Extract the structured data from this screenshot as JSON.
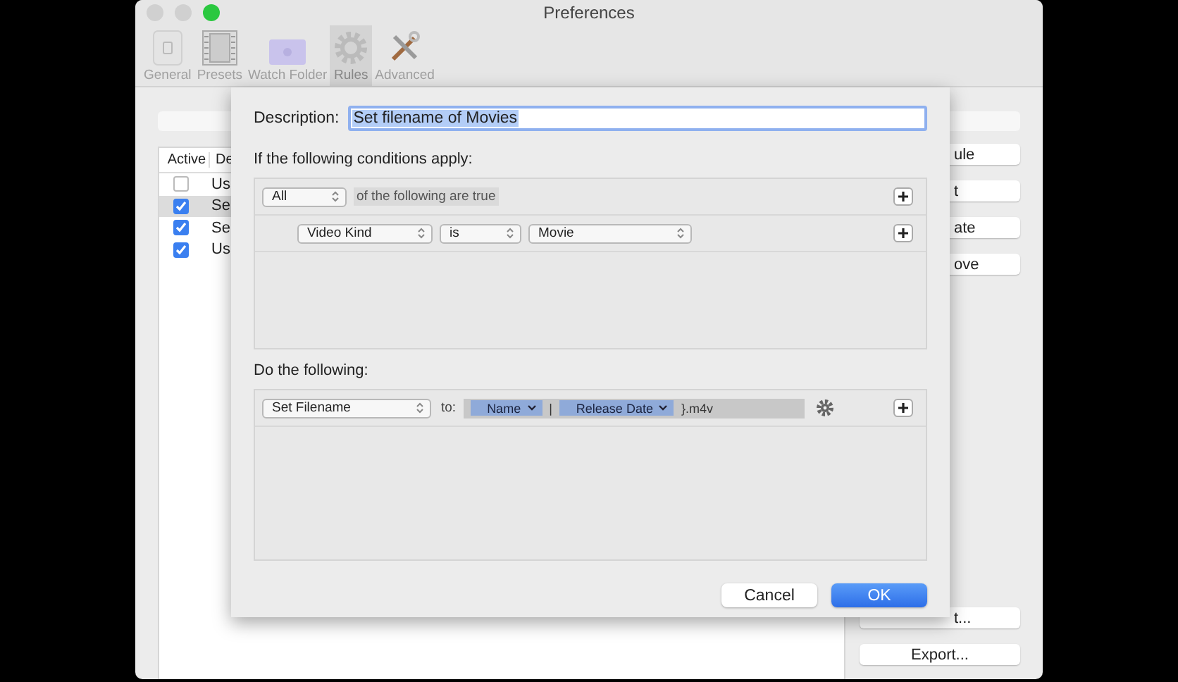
{
  "window": {
    "title": "Preferences"
  },
  "toolbar": [
    {
      "label": "General",
      "selected": false
    },
    {
      "label": "Presets",
      "selected": false
    },
    {
      "label": "Watch Folder",
      "selected": false
    },
    {
      "label": "Rules",
      "selected": true
    },
    {
      "label": "Advanced",
      "selected": false
    }
  ],
  "rules_table": {
    "columns": [
      "Active",
      "De"
    ],
    "rows": [
      {
        "active": false,
        "description": "Us",
        "selected": false
      },
      {
        "active": true,
        "description": "Se",
        "selected": true
      },
      {
        "active": true,
        "description": "Se",
        "selected": false
      },
      {
        "active": true,
        "description": "Us",
        "selected": false
      }
    ]
  },
  "side_buttons": [
    "ule",
    "t",
    "ate",
    "ove",
    "t...",
    "Export..."
  ],
  "sheet": {
    "description_label": "Description:",
    "description_value": "Set filename of Movies",
    "conditions_heading": "If the following conditions apply:",
    "match_popup": "All",
    "match_text": "of the following are true",
    "conditions": [
      {
        "field": "Video Kind",
        "operator": "is",
        "value": "Movie"
      }
    ],
    "actions_heading": "Do the following:",
    "actions": [
      {
        "action": "Set Filename",
        "to_label": "to:",
        "tokens": [
          {
            "kind": "token",
            "text": "Name"
          },
          {
            "kind": "text",
            "text": "|"
          },
          {
            "kind": "token",
            "text": "Release Date"
          },
          {
            "kind": "text",
            "text": "}.m4v"
          }
        ]
      }
    ],
    "buttons": [
      {
        "label": "Cancel",
        "default": false
      },
      {
        "label": "OK",
        "default": true
      }
    ]
  }
}
